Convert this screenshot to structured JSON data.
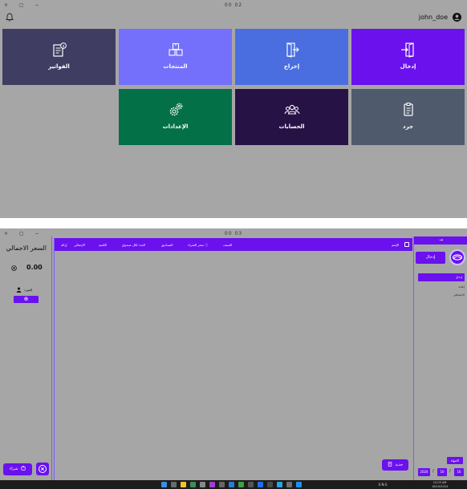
{
  "window1": {
    "controls": "× ▢ −",
    "clock": "00 02",
    "username": "john_doe",
    "tiles": [
      {
        "label": "الفواتير",
        "icon": "invoice-icon",
        "color": "#3f3d62"
      },
      {
        "label": "المنتجات",
        "icon": "boxes-icon",
        "color": "#7470fb"
      },
      {
        "label": "إخراج",
        "icon": "exit-door-icon",
        "color": "#4a6ee0"
      },
      {
        "label": "إدخال",
        "icon": "enter-door-icon",
        "color": "#6a11ee"
      },
      {
        "label": "الإعدادات",
        "icon": "gears-icon",
        "color": "#037048"
      },
      {
        "label": "الحسابات",
        "icon": "users-icon",
        "color": "#271246"
      },
      {
        "label": "جرد",
        "icon": "inventory-icon",
        "color": "#4f5a6d"
      }
    ]
  },
  "window2": {
    "controls": "× ▢ −",
    "clock": "00 03",
    "left_panel": {
      "total_label": "السعر الاجمالي",
      "total_value": "0.00",
      "supplier_label": "المورد",
      "add_symbol": "⊕",
      "buy_label": "شراء"
    },
    "table": {
      "columns": [
        "الإسم",
        "الصنف",
        "سعر الشراء ⓘ",
        "الصناديق",
        "العدد لكل صندوق",
        "الكمية",
        "الإجمالي",
        "إزالة"
      ],
      "rows": [],
      "new_label": "جديد"
    },
    "right_panel": {
      "arrow": "→",
      "mode_button": "إدخال",
      "mode_items": [
        "إدخال",
        "إعادة",
        "الاحتياطي"
      ],
      "status_label": "الانتهاء",
      "date_day": "16",
      "date_month": "10",
      "date_year": "2024",
      "date_sep": "/"
    }
  },
  "taskbar": {
    "tray_text": "ENG",
    "time": "12:03 AM",
    "date": "16/10/2024"
  },
  "colors": {
    "accent": "#6a11ee",
    "background": "#a6a6a6"
  }
}
